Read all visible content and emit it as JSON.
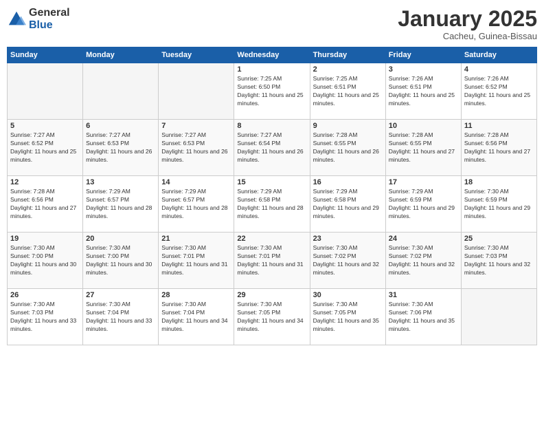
{
  "header": {
    "logo_general": "General",
    "logo_blue": "Blue",
    "title": "January 2025",
    "location": "Cacheu, Guinea-Bissau"
  },
  "days_of_week": [
    "Sunday",
    "Monday",
    "Tuesday",
    "Wednesday",
    "Thursday",
    "Friday",
    "Saturday"
  ],
  "weeks": [
    [
      {
        "day": "",
        "empty": true
      },
      {
        "day": "",
        "empty": true
      },
      {
        "day": "",
        "empty": true
      },
      {
        "day": "1",
        "sunrise": "7:25 AM",
        "sunset": "6:50 PM",
        "daylight": "11 hours and 25 minutes."
      },
      {
        "day": "2",
        "sunrise": "7:25 AM",
        "sunset": "6:51 PM",
        "daylight": "11 hours and 25 minutes."
      },
      {
        "day": "3",
        "sunrise": "7:26 AM",
        "sunset": "6:51 PM",
        "daylight": "11 hours and 25 minutes."
      },
      {
        "day": "4",
        "sunrise": "7:26 AM",
        "sunset": "6:52 PM",
        "daylight": "11 hours and 25 minutes."
      }
    ],
    [
      {
        "day": "5",
        "sunrise": "7:27 AM",
        "sunset": "6:52 PM",
        "daylight": "11 hours and 25 minutes."
      },
      {
        "day": "6",
        "sunrise": "7:27 AM",
        "sunset": "6:53 PM",
        "daylight": "11 hours and 26 minutes."
      },
      {
        "day": "7",
        "sunrise": "7:27 AM",
        "sunset": "6:53 PM",
        "daylight": "11 hours and 26 minutes."
      },
      {
        "day": "8",
        "sunrise": "7:27 AM",
        "sunset": "6:54 PM",
        "daylight": "11 hours and 26 minutes."
      },
      {
        "day": "9",
        "sunrise": "7:28 AM",
        "sunset": "6:55 PM",
        "daylight": "11 hours and 26 minutes."
      },
      {
        "day": "10",
        "sunrise": "7:28 AM",
        "sunset": "6:55 PM",
        "daylight": "11 hours and 27 minutes."
      },
      {
        "day": "11",
        "sunrise": "7:28 AM",
        "sunset": "6:56 PM",
        "daylight": "11 hours and 27 minutes."
      }
    ],
    [
      {
        "day": "12",
        "sunrise": "7:28 AM",
        "sunset": "6:56 PM",
        "daylight": "11 hours and 27 minutes."
      },
      {
        "day": "13",
        "sunrise": "7:29 AM",
        "sunset": "6:57 PM",
        "daylight": "11 hours and 28 minutes."
      },
      {
        "day": "14",
        "sunrise": "7:29 AM",
        "sunset": "6:57 PM",
        "daylight": "11 hours and 28 minutes."
      },
      {
        "day": "15",
        "sunrise": "7:29 AM",
        "sunset": "6:58 PM",
        "daylight": "11 hours and 28 minutes."
      },
      {
        "day": "16",
        "sunrise": "7:29 AM",
        "sunset": "6:58 PM",
        "daylight": "11 hours and 29 minutes."
      },
      {
        "day": "17",
        "sunrise": "7:29 AM",
        "sunset": "6:59 PM",
        "daylight": "11 hours and 29 minutes."
      },
      {
        "day": "18",
        "sunrise": "7:30 AM",
        "sunset": "6:59 PM",
        "daylight": "11 hours and 29 minutes."
      }
    ],
    [
      {
        "day": "19",
        "sunrise": "7:30 AM",
        "sunset": "7:00 PM",
        "daylight": "11 hours and 30 minutes."
      },
      {
        "day": "20",
        "sunrise": "7:30 AM",
        "sunset": "7:00 PM",
        "daylight": "11 hours and 30 minutes."
      },
      {
        "day": "21",
        "sunrise": "7:30 AM",
        "sunset": "7:01 PM",
        "daylight": "11 hours and 31 minutes."
      },
      {
        "day": "22",
        "sunrise": "7:30 AM",
        "sunset": "7:01 PM",
        "daylight": "11 hours and 31 minutes."
      },
      {
        "day": "23",
        "sunrise": "7:30 AM",
        "sunset": "7:02 PM",
        "daylight": "11 hours and 32 minutes."
      },
      {
        "day": "24",
        "sunrise": "7:30 AM",
        "sunset": "7:02 PM",
        "daylight": "11 hours and 32 minutes."
      },
      {
        "day": "25",
        "sunrise": "7:30 AM",
        "sunset": "7:03 PM",
        "daylight": "11 hours and 32 minutes."
      }
    ],
    [
      {
        "day": "26",
        "sunrise": "7:30 AM",
        "sunset": "7:03 PM",
        "daylight": "11 hours and 33 minutes."
      },
      {
        "day": "27",
        "sunrise": "7:30 AM",
        "sunset": "7:04 PM",
        "daylight": "11 hours and 33 minutes."
      },
      {
        "day": "28",
        "sunrise": "7:30 AM",
        "sunset": "7:04 PM",
        "daylight": "11 hours and 34 minutes."
      },
      {
        "day": "29",
        "sunrise": "7:30 AM",
        "sunset": "7:05 PM",
        "daylight": "11 hours and 34 minutes."
      },
      {
        "day": "30",
        "sunrise": "7:30 AM",
        "sunset": "7:05 PM",
        "daylight": "11 hours and 35 minutes."
      },
      {
        "day": "31",
        "sunrise": "7:30 AM",
        "sunset": "7:06 PM",
        "daylight": "11 hours and 35 minutes."
      },
      {
        "day": "",
        "empty": true
      }
    ]
  ]
}
